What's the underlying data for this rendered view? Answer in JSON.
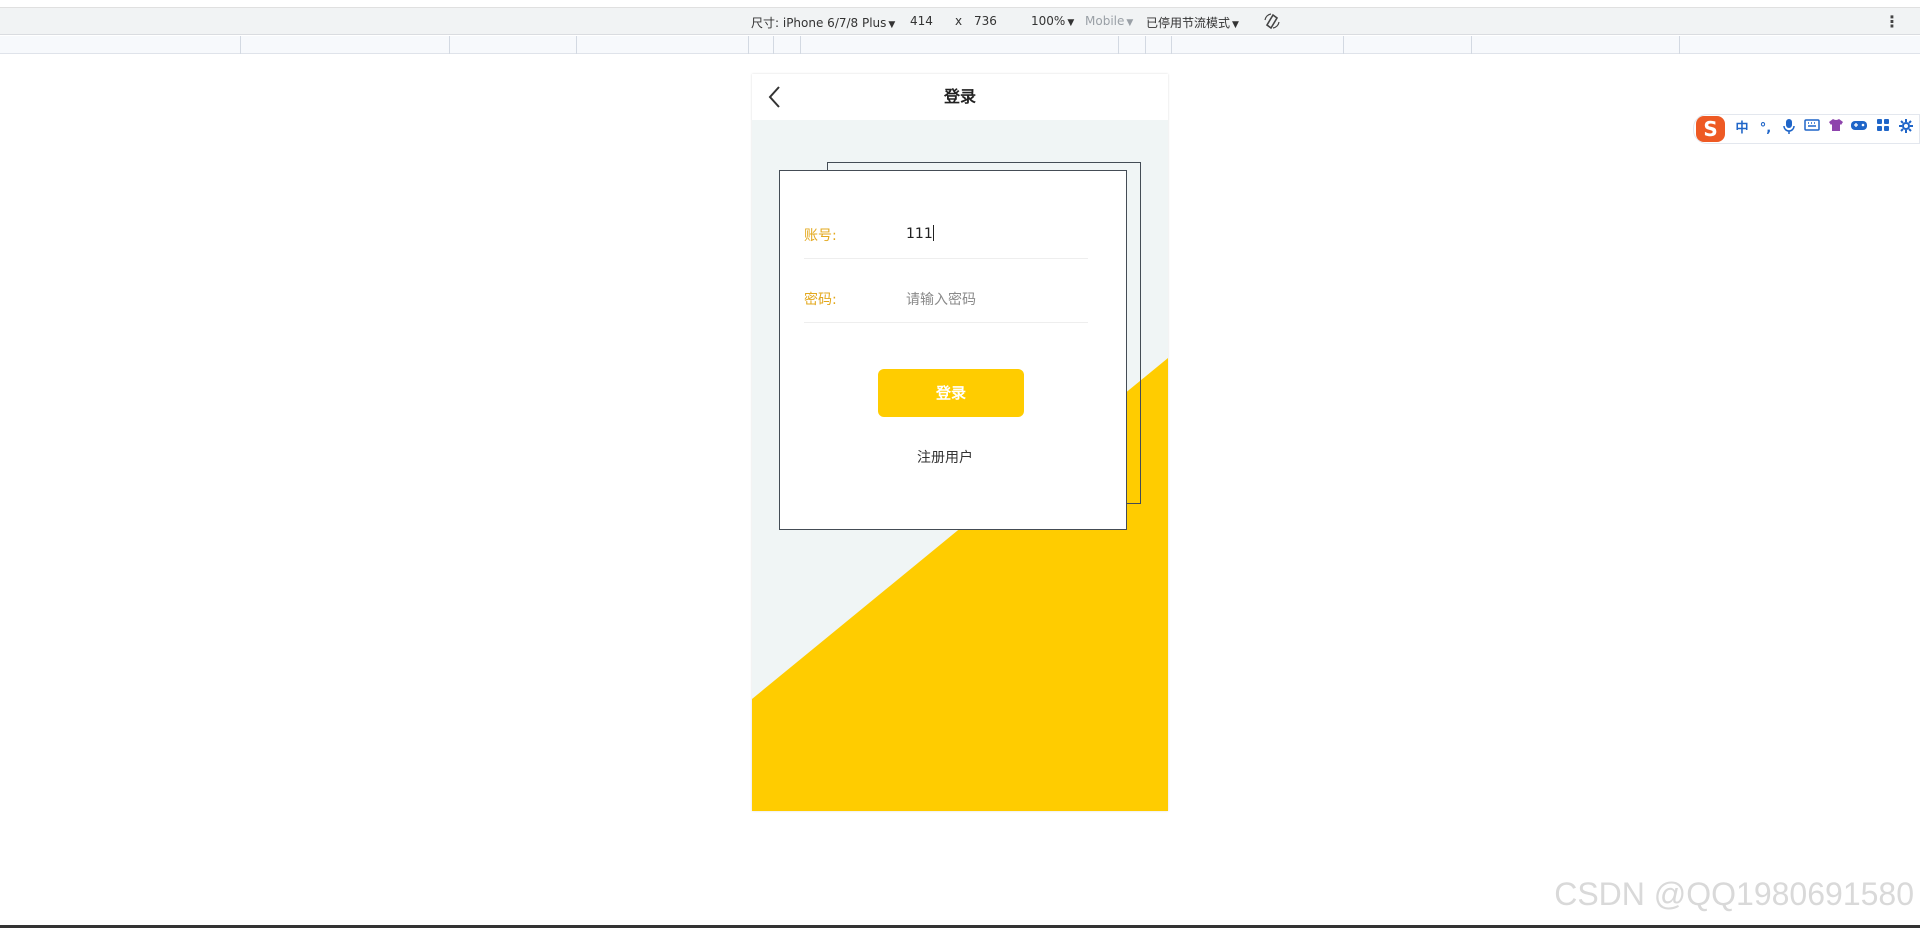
{
  "devtools": {
    "device": "尺寸: iPhone 6/7/8 Plus",
    "width": "414",
    "times": "x",
    "height": "736",
    "zoom": "100%",
    "mode": "Mobile",
    "throttle": "已停用节流模式"
  },
  "ime": {
    "logo": "S",
    "lang": "中",
    "punct": "°,",
    "icons": [
      "microphone-icon",
      "keyboard-icon",
      "skin-icon",
      "game-icon",
      "apps-icon",
      "settings-icon"
    ]
  },
  "app": {
    "nav_title": "登录",
    "account_label": "账号:",
    "account_value": "111",
    "password_label": "密码:",
    "password_placeholder": "请输入密码",
    "login_button": "登录",
    "register_link": "注册用户"
  },
  "colors": {
    "accent": "#ffcc00",
    "label": "#e3a81d",
    "background": "#f0f5f5"
  },
  "watermark": "CSDN @QQ1980691580"
}
